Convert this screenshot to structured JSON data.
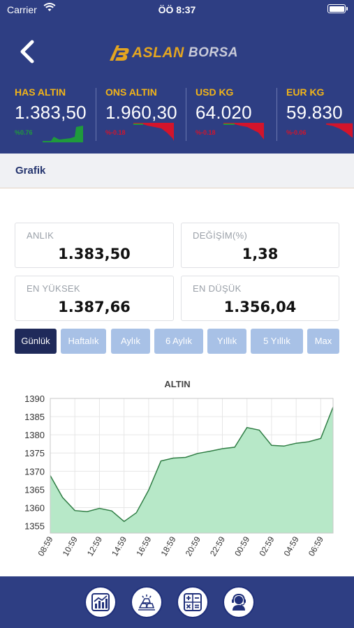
{
  "status_bar": {
    "carrier": "Carrier",
    "time": "ÖÖ 8:37"
  },
  "header": {
    "logo_primary": "ASLAN",
    "logo_secondary": "BORSA",
    "back_icon": "chevron-left-icon"
  },
  "tickers": [
    {
      "name": "HAS ALTIN",
      "value": "1.383,50",
      "change": "%0.76",
      "trend": "up",
      "color": "#1f9a3c"
    },
    {
      "name": "ONS ALTIN",
      "value": "1.960,30",
      "change": "%-0.18",
      "trend": "down",
      "color": "#d3142b"
    },
    {
      "name": "USD KG",
      "value": "64.020",
      "change": "%-0.18",
      "trend": "down",
      "color": "#d3142b"
    },
    {
      "name": "EUR KG",
      "value": "59.830",
      "change": "%-0.06",
      "trend": "down",
      "color": "#d3142b"
    }
  ],
  "section": {
    "title": "Grafik"
  },
  "stats": {
    "anlik": {
      "label": "ANLIK",
      "value": "1.383,50"
    },
    "degisim": {
      "label": "DEĞİŞİM(%)",
      "value": "1,38"
    },
    "en_yuksek": {
      "label": "EN YÜKSEK",
      "value": "1.387,66"
    },
    "en_dusuk": {
      "label": "EN DÜŞÜK",
      "value": "1.356,04"
    }
  },
  "periods": [
    "Günlük",
    "Haftalık",
    "Aylık",
    "6 Aylık",
    "Yıllık",
    "5 Yıllık",
    "Max"
  ],
  "active_period": "Günlük",
  "chart_data": {
    "type": "area",
    "title": "ALTIN",
    "x": [
      "08:59",
      "09:59",
      "10:59",
      "11:59",
      "12:59",
      "13:59",
      "14:59",
      "15:59",
      "16:59",
      "17:59",
      "18:59",
      "19:59",
      "20:59",
      "21:59",
      "22:59",
      "23:59",
      "00:59",
      "01:59",
      "02:59",
      "03:59",
      "04:59",
      "05:59",
      "06:59",
      "07:59"
    ],
    "y_ticks": [
      1355,
      1360,
      1365,
      1370,
      1375,
      1380,
      1385,
      1390
    ],
    "x_ticks": [
      "08:59",
      "10:59",
      "12:59",
      "14:59",
      "16:59",
      "18:59",
      "20:59",
      "22:59",
      "00:59",
      "02:59",
      "04:59",
      "06:59"
    ],
    "series": [
      {
        "values": [
          1368.8,
          1362.8,
          1359.2,
          1358.9,
          1359.8,
          1359.1,
          1356.2,
          1358.6,
          1364.8,
          1372.8,
          1373.6,
          1373.8,
          1374.9,
          1375.5,
          1376.2,
          1376.6,
          1382.0,
          1381.3,
          1377.1,
          1376.9,
          1377.7,
          1378.1,
          1379.0,
          1387.6
        ]
      }
    ],
    "ylim": [
      1353,
      1390
    ],
    "grid": true,
    "fill_color": "#b7e8c8",
    "line_color": "#2f7d44"
  },
  "bottom_nav": [
    {
      "name": "chart-icon"
    },
    {
      "name": "gold-bars-icon"
    },
    {
      "name": "calculator-icon"
    },
    {
      "name": "support-agent-icon"
    }
  ]
}
